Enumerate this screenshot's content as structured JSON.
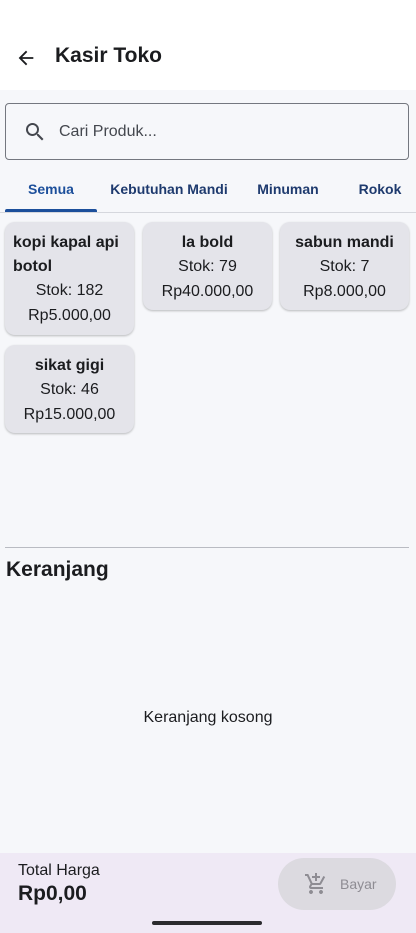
{
  "app_bar": {
    "title": "Kasir Toko"
  },
  "search": {
    "placeholder": "Cari Produk...",
    "value": ""
  },
  "tabs": [
    {
      "label": "Semua",
      "active": true
    },
    {
      "label": "Kebutuhan Mandi",
      "active": false
    },
    {
      "label": "Minuman",
      "active": false
    },
    {
      "label": "Rokok",
      "active": false
    }
  ],
  "products": [
    {
      "name": "kopi kapal api botol",
      "stock": "Stok: 182",
      "price": "Rp5.000,00"
    },
    {
      "name": "la bold",
      "stock": "Stok: 79",
      "price": "Rp40.000,00"
    },
    {
      "name": "sabun mandi",
      "stock": "Stok: 7",
      "price": "Rp8.000,00"
    },
    {
      "name": "sikat gigi",
      "stock": "Stok: 46",
      "price": "Rp15.000,00"
    }
  ],
  "cart": {
    "title": "Keranjang",
    "empty_message": "Keranjang kosong"
  },
  "footer": {
    "total_label": "Total Harga",
    "total_value": "Rp0,00",
    "pay_label": "Bayar"
  },
  "colors": {
    "accent": "#1c4f9b",
    "tab_text": "#1e3a6e",
    "card_bg": "#e4e4ea",
    "bottom_bar": "#efe9f5",
    "disabled_btn": "#dcdae0"
  },
  "icons": {
    "back": "arrow-left-icon",
    "search": "search-icon",
    "pay": "cart-add-icon"
  }
}
